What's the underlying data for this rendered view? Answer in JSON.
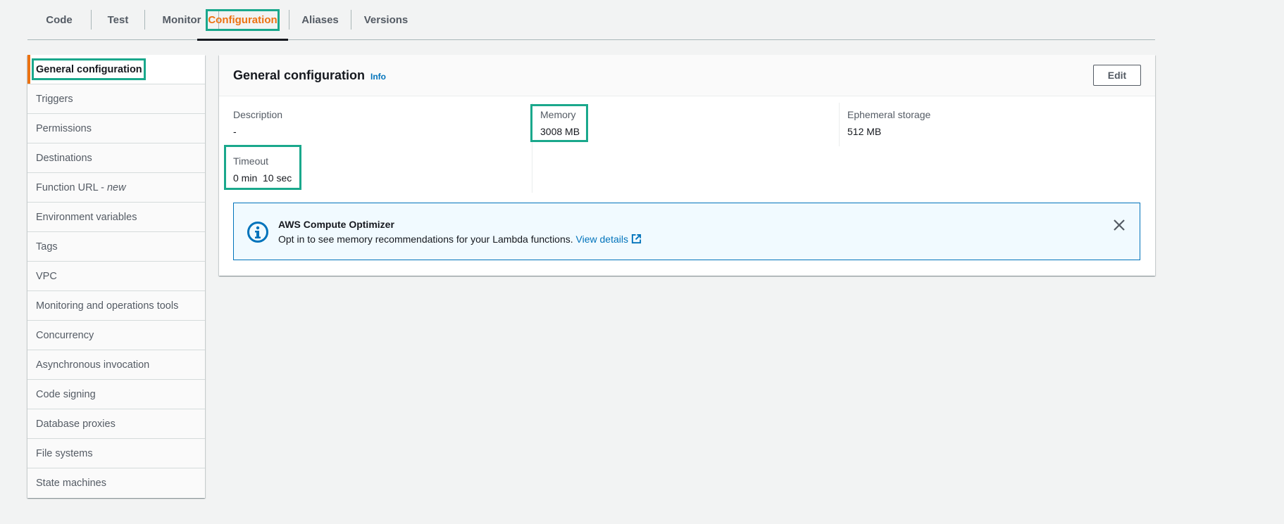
{
  "tabs": [
    {
      "label": "Code"
    },
    {
      "label": "Test"
    },
    {
      "label": "Monitor"
    },
    {
      "label": "Configuration"
    },
    {
      "label": "Aliases"
    },
    {
      "label": "Versions"
    }
  ],
  "sidebar": {
    "items": [
      {
        "label": "General configuration"
      },
      {
        "label": "Triggers"
      },
      {
        "label": "Permissions"
      },
      {
        "label": "Destinations"
      },
      {
        "label": "Function URL -",
        "suffix": "new"
      },
      {
        "label": "Environment variables"
      },
      {
        "label": "Tags"
      },
      {
        "label": "VPC"
      },
      {
        "label": "Monitoring and operations tools"
      },
      {
        "label": "Concurrency"
      },
      {
        "label": "Asynchronous invocation"
      },
      {
        "label": "Code signing"
      },
      {
        "label": "Database proxies"
      },
      {
        "label": "File systems"
      },
      {
        "label": "State machines"
      }
    ]
  },
  "panel": {
    "title": "General configuration",
    "info_label": "Info",
    "edit_label": "Edit",
    "fields": {
      "description": {
        "label": "Description",
        "value": "-"
      },
      "memory": {
        "label": "Memory",
        "value": "3008 MB"
      },
      "ephemeral": {
        "label": "Ephemeral storage",
        "value": "512 MB"
      },
      "timeout": {
        "label": "Timeout",
        "value": "0 min  10 sec"
      }
    },
    "alert": {
      "title": "AWS Compute Optimizer",
      "text": "Opt in to see memory recommendations for your Lambda functions.",
      "link_label": "View details"
    }
  },
  "colors": {
    "accent": "#ec7211",
    "link": "#0073bb",
    "highlight": "#1aa88c"
  },
  "icons": [
    "info-circle-icon",
    "external-link-icon",
    "close-icon"
  ]
}
